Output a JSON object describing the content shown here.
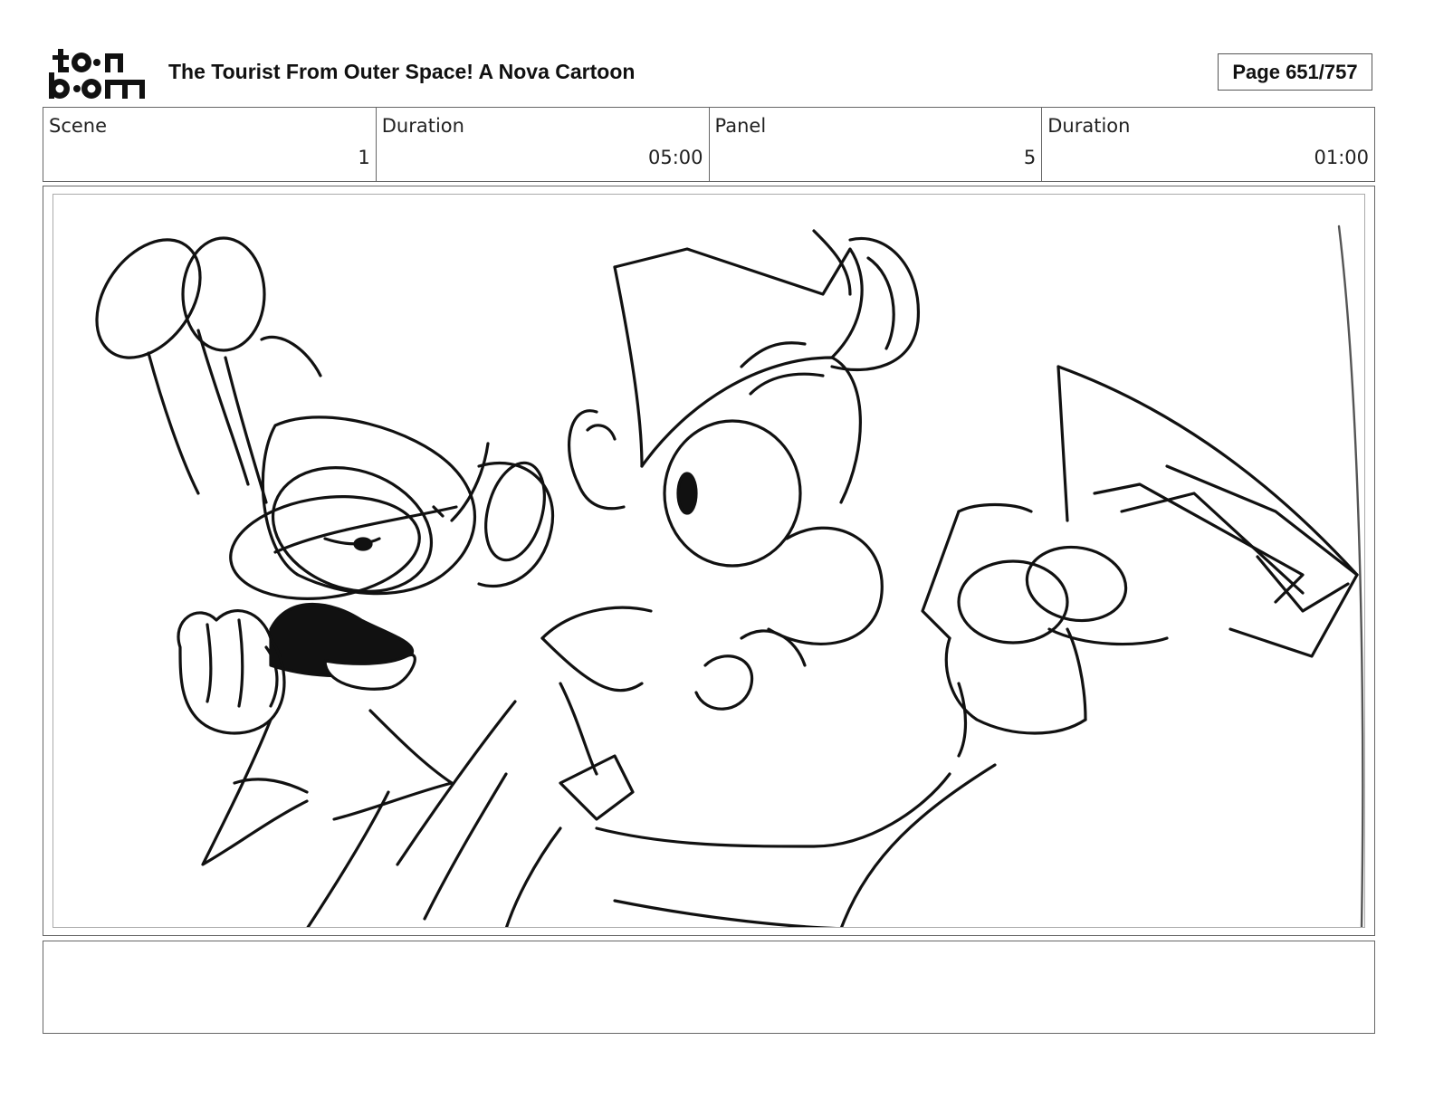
{
  "header": {
    "logo_icon": "toon-boom-logo",
    "logo_text_top": "toon",
    "logo_text_bottom": "boom",
    "title": "The Tourist From Outer Space!  A Nova Cartoon",
    "page_label": "Page 651/757"
  },
  "info": {
    "scene_label": "Scene",
    "scene_value": "1",
    "scene_duration_label": "Duration",
    "scene_duration_value": "05:00",
    "panel_label": "Panel",
    "panel_value": "5",
    "panel_duration_label": "Duration",
    "panel_duration_value": "01:00"
  },
  "panel": {
    "image_icon": "storyboard-sketch"
  },
  "notes": {
    "text": ""
  }
}
